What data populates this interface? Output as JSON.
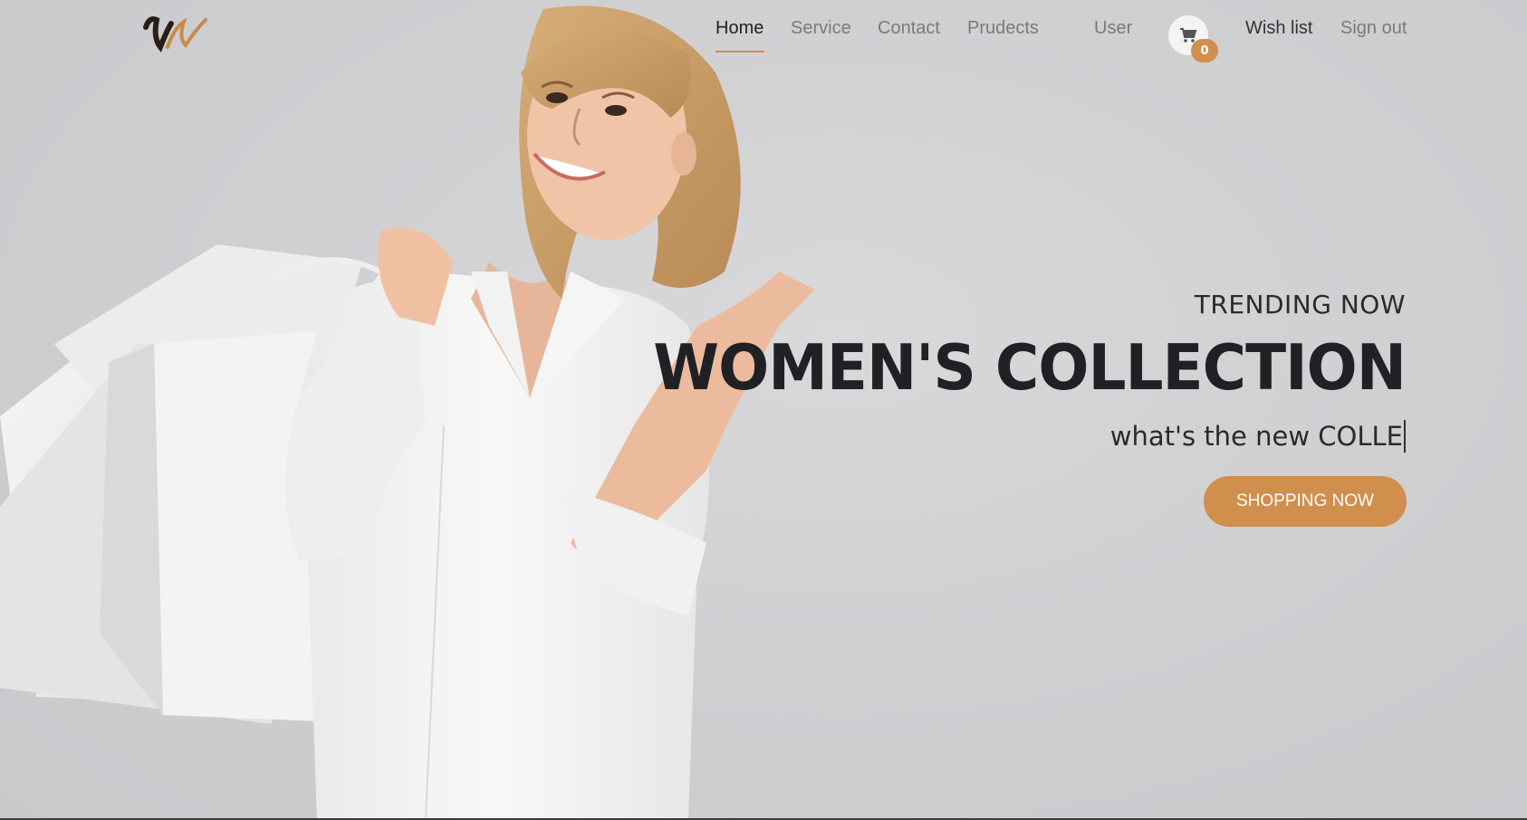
{
  "brand": {
    "logo_letter": "W",
    "accent_color": "#d08f4c"
  },
  "nav": {
    "links": [
      {
        "label": "Home",
        "active": true
      },
      {
        "label": "Service",
        "active": false
      },
      {
        "label": "Contact",
        "active": false
      },
      {
        "label": "Prudects",
        "active": false
      }
    ],
    "user_label": "User",
    "cart": {
      "icon": "cart-icon",
      "count": "0"
    },
    "wishlist_label": "Wish list",
    "signout_label": "Sign out"
  },
  "hero": {
    "kicker": "TRENDING NOW",
    "headline": "WOMEN'S COLLECTION",
    "typed_text": "what's the new COLLE",
    "cta_label": "SHOPPING NOW"
  }
}
